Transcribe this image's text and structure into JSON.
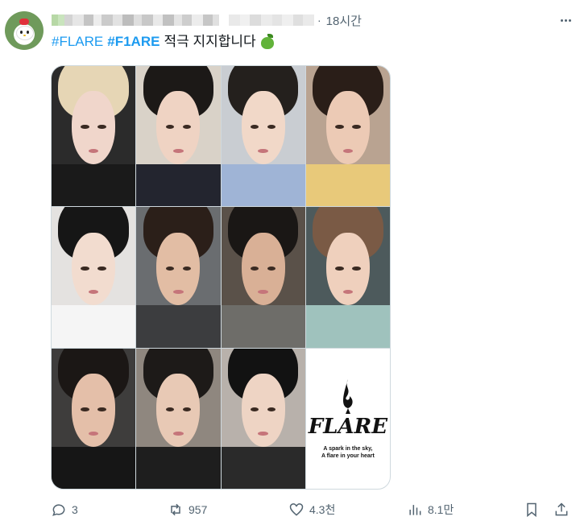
{
  "post": {
    "time": "18시간",
    "dot": "·",
    "text": {
      "hashtag1": "#FLARE",
      "hashtag2": "#F1ARE",
      "body": "적극 지지합니다"
    },
    "media": {
      "logo_word": "FLARE",
      "logo_tagline_1": "A spark in the sky,",
      "logo_tagline_2": "A flare in your heart"
    }
  },
  "actions": {
    "replies": "3",
    "reposts": "957",
    "likes": "4.3천",
    "views": "8.1만"
  },
  "icons": {
    "reply": "comment-icon",
    "repost": "repost-icon",
    "like": "heart-icon",
    "views": "analytics-icon",
    "bookmark": "bookmark-icon",
    "share": "share-icon",
    "more": "more-icon",
    "emoji": "green-apple-icon"
  },
  "colors": {
    "link": "#1d9bf0",
    "secondary_text": "#536471",
    "border": "#cfd9de"
  }
}
